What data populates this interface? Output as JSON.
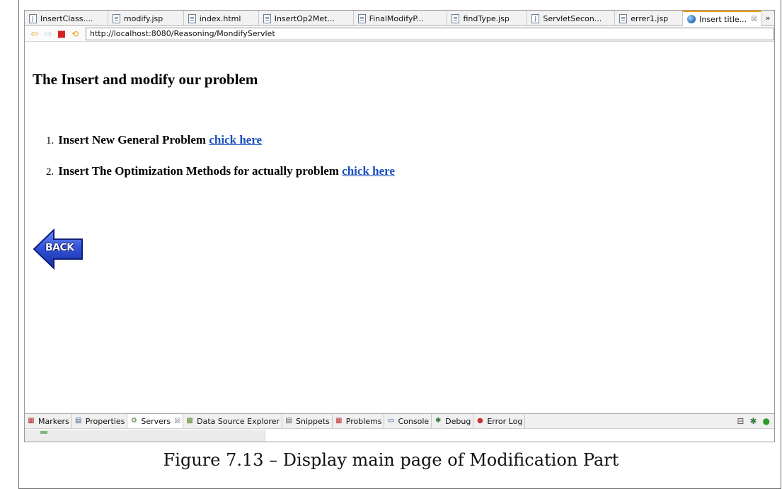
{
  "editor_tabs": [
    {
      "label": "InsertClass....",
      "icon": "java-file-icon",
      "glyph": "J"
    },
    {
      "label": "modify.jsp",
      "icon": "file-icon",
      "glyph": ""
    },
    {
      "label": "index.html",
      "icon": "file-icon",
      "glyph": ""
    },
    {
      "label": "InsertOp2Met...",
      "icon": "file-icon",
      "glyph": ""
    },
    {
      "label": "FinalModifyP...",
      "icon": "file-icon",
      "glyph": ""
    },
    {
      "label": "findType.jsp",
      "icon": "file-icon",
      "glyph": ""
    },
    {
      "label": "ServletSecon...",
      "icon": "java-file-icon",
      "glyph": "J"
    },
    {
      "label": "errer1.jsp",
      "icon": "file-icon",
      "glyph": ""
    },
    {
      "label": "Insert title...",
      "icon": "globe-icon",
      "glyph": "",
      "active": true,
      "close": "☒"
    }
  ],
  "tab_overflow": "»",
  "browser": {
    "url": "http://localhost:8080/Reasoning/MondifyServlet",
    "back_glyph": "⇦",
    "forward_glyph": "⇨",
    "stop_glyph": "■",
    "refresh_glyph": "⟲"
  },
  "page": {
    "heading": "The Insert and modify our problem",
    "items": [
      {
        "num": "1.",
        "text": "Insert New General Problem",
        "link": "chick here"
      },
      {
        "num": "2.",
        "text": "Insert The Optimization Methods for actually problem",
        "link": "chick here"
      }
    ],
    "back_button_label": "BACK"
  },
  "view_tabs": [
    {
      "label": "Markers",
      "icon": "markers-icon",
      "glyph": "▦",
      "color": "#b03030"
    },
    {
      "label": "Properties",
      "icon": "properties-icon",
      "glyph": "▤",
      "color": "#3a5a8a"
    },
    {
      "label": "Servers",
      "icon": "servers-icon",
      "glyph": "⚙",
      "color": "#4a7a3a",
      "active": true,
      "close": "☒"
    },
    {
      "label": "Data Source Explorer",
      "icon": "data-source-icon",
      "glyph": "▩",
      "color": "#5a8a2a"
    },
    {
      "label": "Snippets",
      "icon": "snippets-icon",
      "glyph": "▤",
      "color": "#555555"
    },
    {
      "label": "Problems",
      "icon": "problems-icon",
      "glyph": "▦",
      "color": "#c03030"
    },
    {
      "label": "Console",
      "icon": "console-icon",
      "glyph": "▭",
      "color": "#2a4a8a"
    },
    {
      "label": "Debug",
      "icon": "debug-icon",
      "glyph": "✱",
      "color": "#3a7a3a"
    },
    {
      "label": "Error Log",
      "icon": "error-log-icon",
      "glyph": "●",
      "color": "#d03030"
    }
  ],
  "view_controls": {
    "minimize_glyph": "⊟",
    "debug_glyph": "✱",
    "run_glyph": "●"
  },
  "caption": "Figure 7.13 – Display main page of Modification Part"
}
